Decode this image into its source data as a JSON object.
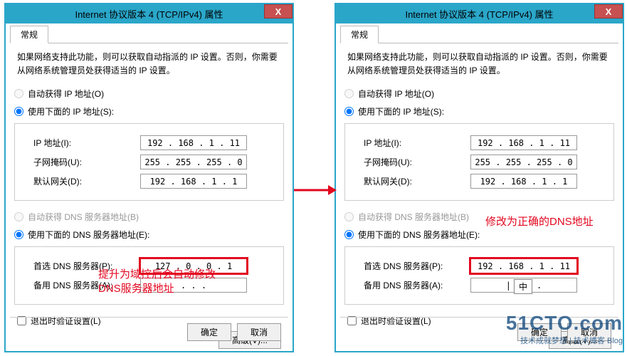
{
  "window": {
    "title": "Internet 协议版本 4 (TCP/IPv4) 属性",
    "close_glyph": "X",
    "tab_general": "常规",
    "description": "如果网络支持此功能，则可以获取自动指派的 IP 设置。否则，你需要从网络系统管理员处获得适当的 IP 设置。",
    "radio_auto_ip": "自动获得 IP 地址(O)",
    "radio_use_ip": "使用下面的 IP 地址(S):",
    "lbl_ip": "IP 地址(I):",
    "lbl_mask": "子网掩码(U):",
    "lbl_gw": "默认网关(D):",
    "radio_auto_dns": "自动获得 DNS 服务器地址(B)",
    "radio_use_dns": "使用下面的 DNS 服务器地址(E):",
    "lbl_dns1": "首选 DNS 服务器(P):",
    "lbl_dns2": "备用 DNS 服务器(A):",
    "chk_validate": "退出时验证设置(L)",
    "btn_advanced": "高级(V)...",
    "btn_ok": "确定",
    "btn_cancel": "取消"
  },
  "left": {
    "ip": "192 . 168 .  1  . 11",
    "mask": "255 . 255 . 255 .  0",
    "gw": "192 . 168 .  1  .  1",
    "dns1": "127 .  0  .  0  .  1",
    "dns2": "  .     .     .  ",
    "note": "提升为域控后会自动修改\nDNS服务器地址"
  },
  "right": {
    "ip": "192 . 168 .  1  . 11",
    "mask": "255 . 255 . 255 .  0",
    "gw": "192 . 168 .  1  .  1",
    "dns1": "192 . 168 .  1  . 11",
    "dns2": "|  .     .     .  ",
    "note": "修改为正确的DNS地址",
    "ime": "中"
  },
  "watermark": {
    "big": "51CTO.com",
    "small": "技术成就梦想 | 技术博客 Blog"
  }
}
